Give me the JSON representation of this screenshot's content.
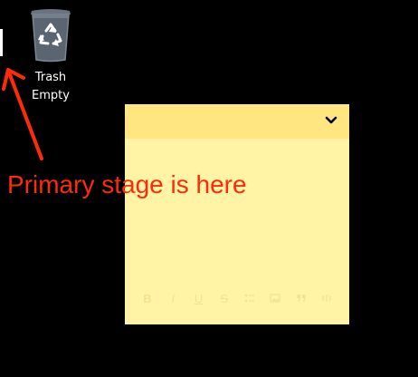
{
  "desktop": {
    "trash": {
      "icon": "recycle-bin-icon",
      "name": "Trash",
      "status": "Empty"
    }
  },
  "annotation": {
    "text": "Primary stage is here",
    "color": "#ff2a0a"
  },
  "sticky_note": {
    "header_color": "#ffe680",
    "body_color": "#fff4a6",
    "menu_icon": "chevron-down-icon",
    "toolbar": [
      "B",
      "I",
      "U",
      "S",
      "bullets-icon",
      "image-icon",
      "quote-icon",
      "voice-icon"
    ]
  }
}
